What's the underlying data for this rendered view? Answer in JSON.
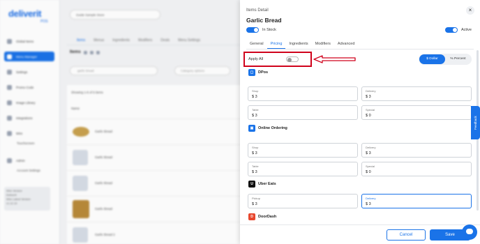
{
  "background": {
    "logo": "deliverit",
    "logo_sub": "POS",
    "sidebar": [
      "Global Items",
      "Menu Manager",
      "Settings",
      "Promo Code",
      "Image Library",
      "Integrations",
      "Wire",
      "Admin"
    ],
    "sidebar_subs": [
      "Touchscreen",
      "Account Settings"
    ],
    "sidebar_box": [
      "Wire Version",
      "DeliverIt",
      "Wire Latest Version",
      "v1.12.19"
    ],
    "store_select": "Guide Sample Store",
    "tabs": [
      "Items",
      "Menus",
      "Ingredients",
      "Modifiers",
      "Deals",
      "Menu Settings"
    ],
    "items_header": "Items",
    "search_placeholder": "garlic bread",
    "category_placeholder": "Category options",
    "showing": "Showing 1-6 of 6 items",
    "col_header": "Name",
    "rows": [
      "Garlic Bread",
      "Garlic Bread",
      "Garlic Bread",
      "Garlic Bread",
      "Garlic Bread",
      "Garlic Bread 2"
    ]
  },
  "panel": {
    "label": "Items Detail",
    "close": "×",
    "title": "Garlic Bread",
    "in_stock_label": "In Stock",
    "active_label": "Active",
    "tabs": [
      "General",
      "Pricing",
      "Ingredients",
      "Modifiers",
      "Advanced"
    ],
    "active_tab": "Pricing",
    "apply_all_label": "Apply All",
    "segment": {
      "dollar": "$ Dollar",
      "percent": "% Percent"
    },
    "sections": [
      {
        "name": "DPos",
        "icon": "dpos-icon",
        "color": "#1a73e8",
        "fields": [
          {
            "label": "Shop",
            "value": "$ 3"
          },
          {
            "label": "Delivery",
            "value": "$ 3"
          },
          {
            "label": "Table",
            "value": "$ 3"
          },
          {
            "label": "Special",
            "value": "$ 0"
          }
        ]
      },
      {
        "name": "Online Ordering",
        "icon": "online-ordering-icon",
        "color": "#1a73e8",
        "fields": [
          {
            "label": "Shop",
            "value": "$ 3"
          },
          {
            "label": "Delivery",
            "value": "$ 3"
          },
          {
            "label": "Table",
            "value": "$ 3"
          },
          {
            "label": "Special",
            "value": "$ 0"
          }
        ]
      },
      {
        "name": "Uber Eats",
        "icon": "uber-eats-icon",
        "color": "#111111",
        "fields": [
          {
            "label": "Pickup",
            "value": "$ 3"
          },
          {
            "label": "Delivery",
            "value": "$ 3"
          }
        ]
      },
      {
        "name": "DoorDash",
        "icon": "doordash-icon",
        "color": "#e8472e",
        "fields": []
      }
    ],
    "cancel": "Cancel",
    "save": "Save",
    "feedback": "Feedback",
    "accent_color": "#1a73e8",
    "highlight_color": "#d0021b"
  }
}
